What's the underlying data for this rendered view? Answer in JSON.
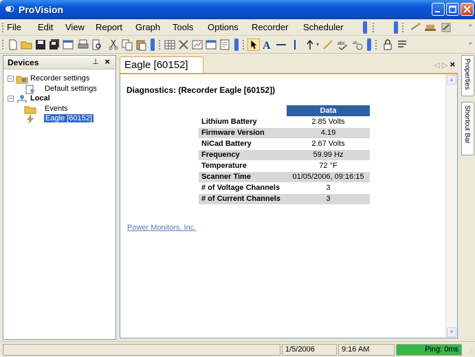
{
  "window": {
    "title": "ProVision"
  },
  "menu": [
    "File",
    "Edit",
    "View",
    "Report",
    "Graph",
    "Tools",
    "Options",
    "Recorder",
    "Scheduler"
  ],
  "devices": {
    "title": "Devices",
    "tree": [
      {
        "label": "Recorder settings"
      },
      {
        "label": "Default settings"
      },
      {
        "label": "Local"
      },
      {
        "label": "Events"
      },
      {
        "label": "Eagle [60152]"
      }
    ]
  },
  "document": {
    "tab_label": "Eagle [60152]",
    "heading": "Diagnostics: (Recorder Eagle [60152])",
    "table_header": "Data",
    "rows": [
      {
        "key": "Lithium Battery",
        "value": "2.85 Volts"
      },
      {
        "key": "Firmware Version",
        "value": "4.19"
      },
      {
        "key": "NiCad Battery",
        "value": "2.67 Volts"
      },
      {
        "key": "Frequency",
        "value": "59.99 Hz"
      },
      {
        "key": "Temperature",
        "value": "72 °F"
      },
      {
        "key": "Scanner Time",
        "value": "01/05/2006, 09:16:15"
      },
      {
        "key": "# of Voltage Channels",
        "value": "3"
      },
      {
        "key": "# of Current Channels",
        "value": "3"
      }
    ],
    "link": "Power Monitors, Inc."
  },
  "side_tabs": {
    "properties": "Properties",
    "shortcut": "Shortcut Bar"
  },
  "status": {
    "date": "1/5/2006",
    "time": "9:16 AM",
    "ping": "Ping: 0ms"
  },
  "colors": {
    "title_bar": "#0b4fcb",
    "table_header": "#2e5fa4",
    "tab_accent": "#e8a040",
    "ping_ok": "#38b54a",
    "selection": "#316ac5"
  }
}
